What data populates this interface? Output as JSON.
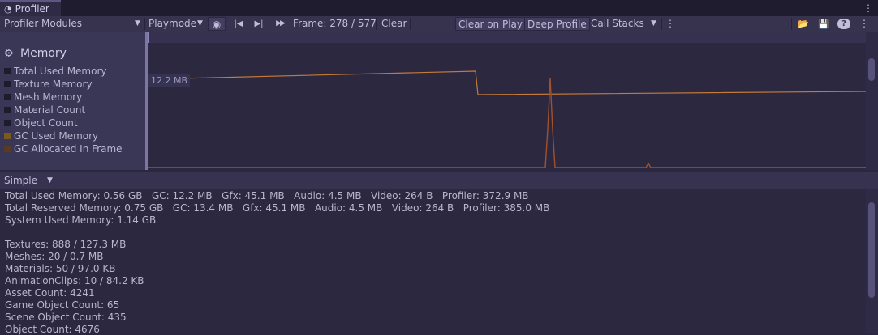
{
  "window": {
    "tab_title": "Profiler",
    "menu_glyph": "⋮"
  },
  "toolbar": {
    "modules_label": "Profiler Modules",
    "modules_arrow": "▼",
    "target_label": "Playmode",
    "target_arrow": "▼",
    "record_glyph": "◉",
    "prev_glyph": "|◀",
    "next_glyph": "▶|",
    "last_glyph": "▶▶",
    "frame_label": "Frame: 278 / 577",
    "clear_label": "Clear",
    "clear_on_play_label": "Clear on Play",
    "deep_profile_label": "Deep Profile",
    "call_stacks_label": "Call Stacks",
    "call_stacks_arrow": "▼",
    "more_glyph": "⋮",
    "load_glyph": "📂",
    "save_glyph": "💾",
    "help_glyph": "?",
    "menu_glyph": "⋮"
  },
  "module": {
    "icon": "⚙",
    "title": "Memory",
    "legend": [
      {
        "label": "Total Used Memory",
        "color": "#1e1b2c"
      },
      {
        "label": "Texture Memory",
        "color": "#1e1b2c"
      },
      {
        "label": "Mesh Memory",
        "color": "#1e1b2c"
      },
      {
        "label": "Material Count",
        "color": "#1e1b2c"
      },
      {
        "label": "Object Count",
        "color": "#1e1b2c"
      },
      {
        "label": "GC Used Memory",
        "color": "#7a5a1e"
      },
      {
        "label": "GC Allocated In Frame",
        "color": "#5a3a22"
      }
    ],
    "y_label": "12.2 MB",
    "line_color": "#c47a3a",
    "spike_color": "#a0522d"
  },
  "details": {
    "view_mode": "Simple",
    "view_arrow": "▼",
    "lines": [
      "Total Used Memory: 0.56 GB   GC: 12.2 MB   Gfx: 45.1 MB   Audio: 4.5 MB   Video: 264 B   Profiler: 372.9 MB",
      "Total Reserved Memory: 0.75 GB   GC: 13.4 MB   Gfx: 45.1 MB   Audio: 4.5 MB   Video: 264 B   Profiler: 385.0 MB",
      "System Used Memory: 1.14 GB",
      "",
      "Textures: 888 / 127.3 MB",
      "Meshes: 20 / 0.7 MB",
      "Materials: 50 / 97.0 KB",
      "AnimationClips: 10 / 84.2 KB",
      "Asset Count: 4241",
      "Game Object Count: 65",
      "Scene Object Count: 435",
      "Object Count: 4676"
    ]
  }
}
